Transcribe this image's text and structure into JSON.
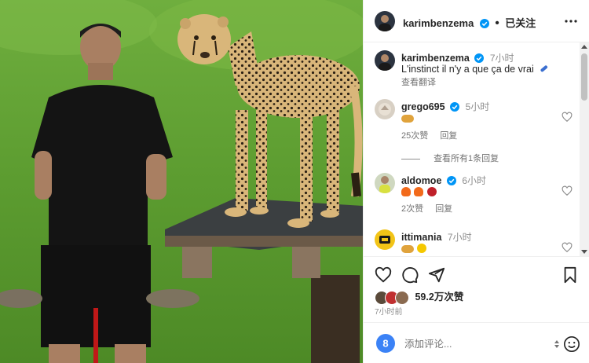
{
  "post": {
    "author": "karimbenzema",
    "follow_status": "已关注",
    "caption_time": "7小时",
    "caption": "L'instinct il n'y a que ça de vrai",
    "translate": "查看翻译",
    "likes": "59.2万次赞",
    "posted_ago": "7小时前"
  },
  "comments": [
    {
      "user": "grego695",
      "time": "5小时",
      "likes": "25次赞",
      "reply": "回复",
      "view_replies": "查看所有1条回复"
    },
    {
      "user": "aldomoe",
      "time": "6小时",
      "likes": "2次赞",
      "reply": "回复"
    },
    {
      "user": "ittimania",
      "time": "7小时"
    }
  ],
  "composer": {
    "placeholder": "添加评论..."
  },
  "icons": [
    "more-icon",
    "heart-icon",
    "comment-icon",
    "share-icon",
    "bookmark-icon",
    "emoji-icon",
    "verified-icon"
  ],
  "colors": {
    "verified": "#0095f6",
    "text": "#262626",
    "muted": "#8e8e8e"
  }
}
